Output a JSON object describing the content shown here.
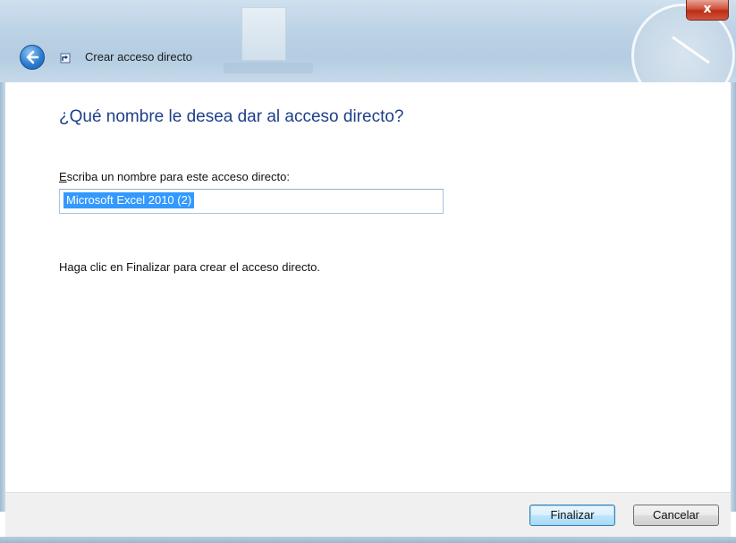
{
  "window": {
    "title": "Crear acceso directo",
    "close_label": "x"
  },
  "page": {
    "heading": "¿Qué nombre le desea dar al acceso directo?",
    "name_label_mnemonic": "E",
    "name_label_rest": "scriba un nombre para este acceso directo:",
    "name_value": "Microsoft Excel 2010 (2)",
    "hint": "Haga clic en Finalizar para crear el acceso directo."
  },
  "footer": {
    "finish_label": "Finalizar",
    "cancel_label": "Cancelar"
  },
  "colors": {
    "heading": "#1e3f8a",
    "selection": "#3399ff",
    "close_button": "#c7422c"
  },
  "icons": {
    "back": "back-arrow-icon",
    "wizard": "shortcut-wizard-icon",
    "close": "close-icon"
  }
}
